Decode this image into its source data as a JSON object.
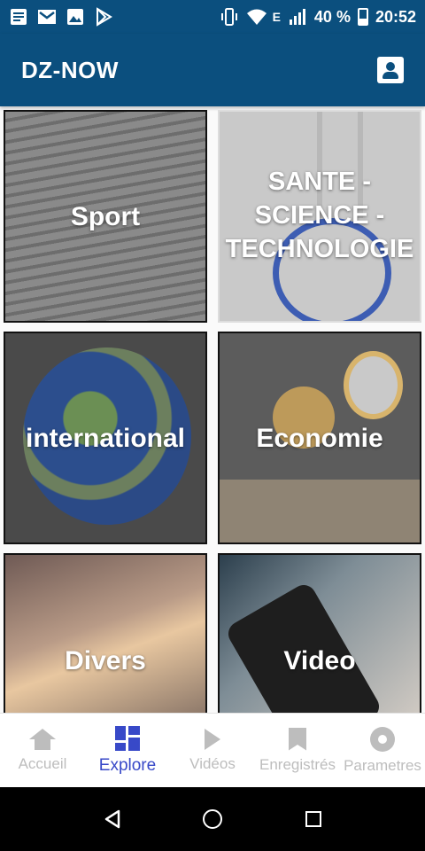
{
  "status_bar": {
    "icons_left": [
      "news-icon",
      "mail-icon",
      "image-icon",
      "play-store-icon"
    ],
    "signal_type": "E",
    "battery": "40 %",
    "time": "20:52"
  },
  "app_bar": {
    "title": "DZ-NOW",
    "profile_icon": "account-box-icon"
  },
  "categories": [
    {
      "label": "Sport"
    },
    {
      "label": "SANTE - SCIENCE - TECHNOLOGIE"
    },
    {
      "label": "international"
    },
    {
      "label": "Economie"
    },
    {
      "label": "Divers"
    },
    {
      "label": "Video"
    }
  ],
  "bottom_nav": {
    "items": [
      {
        "label": "Accueil",
        "icon": "home-icon"
      },
      {
        "label": "Explore",
        "icon": "dashboard-icon"
      },
      {
        "label": "Vidéos",
        "icon": "play-icon"
      },
      {
        "label": "Enregistrés",
        "icon": "bookmark-icon"
      },
      {
        "label": "Parametres",
        "icon": "settings-icon"
      }
    ],
    "active_index": 1
  },
  "colors": {
    "primary": "#0b4f7e",
    "accent": "#3849c8",
    "inactive": "#bdbdbd"
  }
}
